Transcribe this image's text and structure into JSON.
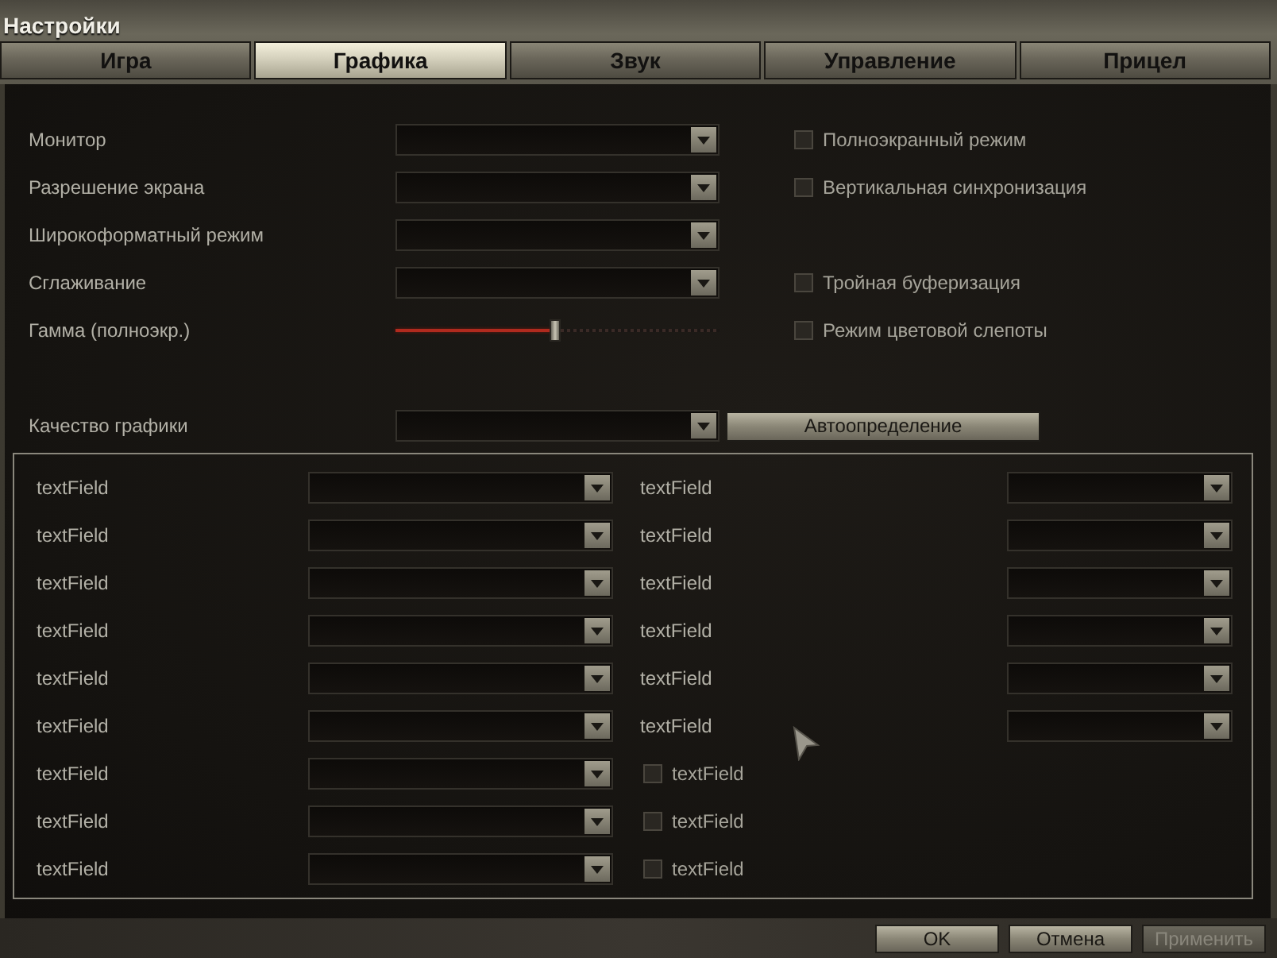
{
  "window": {
    "title": "Настройки"
  },
  "tabs": [
    {
      "label": "Игра",
      "selected": false
    },
    {
      "label": "Графика",
      "selected": true
    },
    {
      "label": "Звук",
      "selected": false
    },
    {
      "label": "Управление",
      "selected": false
    },
    {
      "label": "Прицел",
      "selected": false
    }
  ],
  "settings": [
    {
      "label": "Монитор",
      "kind": "dropdown",
      "checkbox": {
        "label": "Полноэкранный режим",
        "checked": false
      }
    },
    {
      "label": "Разрешение экрана",
      "kind": "dropdown",
      "checkbox": {
        "label": "Вертикальная синхронизация",
        "checked": false
      }
    },
    {
      "label": "Широкоформатный режим",
      "kind": "dropdown"
    },
    {
      "label": "Сглаживание",
      "kind": "dropdown",
      "checkbox": {
        "label": "Тройная буферизация",
        "checked": false
      }
    },
    {
      "label": "Гамма (полноэкр.)",
      "kind": "slider",
      "level": 0.49,
      "checkbox": {
        "label": "Режим цветовой слепоты",
        "checked": false
      }
    }
  ],
  "quality": {
    "label": "Качество графики",
    "button": "Автоопределение"
  },
  "advanced": {
    "left": [
      {
        "label": "textField",
        "kind": "dropdown"
      },
      {
        "label": "textField",
        "kind": "dropdown"
      },
      {
        "label": "textField",
        "kind": "dropdown"
      },
      {
        "label": "textField",
        "kind": "dropdown"
      },
      {
        "label": "textField",
        "kind": "dropdown"
      },
      {
        "label": "textField",
        "kind": "dropdown"
      },
      {
        "label": "textField",
        "kind": "dropdown"
      },
      {
        "label": "textField",
        "kind": "dropdown"
      },
      {
        "label": "textField",
        "kind": "dropdown"
      }
    ],
    "right": [
      {
        "label": "textField",
        "kind": "dropdown"
      },
      {
        "label": "textField",
        "kind": "dropdown"
      },
      {
        "label": "textField",
        "kind": "dropdown"
      },
      {
        "label": "textField",
        "kind": "dropdown"
      },
      {
        "label": "textField",
        "kind": "dropdown"
      },
      {
        "label": "textField",
        "kind": "dropdown"
      },
      {
        "label": "textField",
        "kind": "checkbox",
        "checked": false
      },
      {
        "label": "textField",
        "kind": "checkbox",
        "checked": false
      },
      {
        "label": "textField",
        "kind": "checkbox",
        "checked": false
      }
    ]
  },
  "buttons": [
    {
      "label": "OK",
      "disabled": false
    },
    {
      "label": "Отмена",
      "disabled": false
    },
    {
      "label": "Применить",
      "disabled": true
    }
  ]
}
